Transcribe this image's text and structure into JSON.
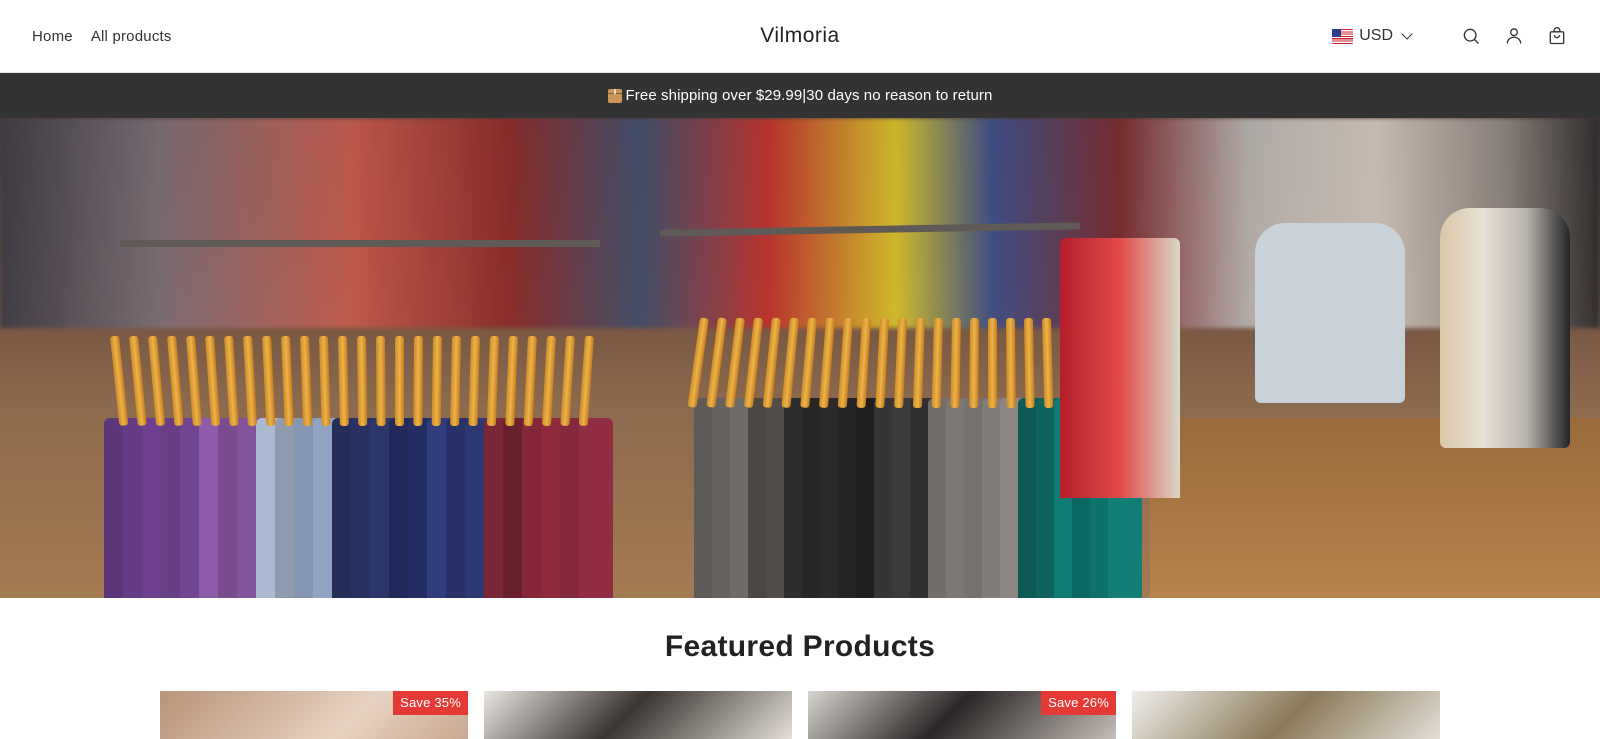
{
  "nav": {
    "home": "Home",
    "all_products": "All products"
  },
  "brand": "Vilmoria",
  "currency": {
    "code": "USD",
    "flag": "us-flag-icon"
  },
  "announcement": "Free shipping over $29.99|30 days no reason to return",
  "featured": {
    "title": "Featured Products",
    "cards": [
      {
        "badge": "Save 35%"
      },
      {
        "badge": ""
      },
      {
        "badge": "Save 26%"
      },
      {
        "badge": ""
      }
    ]
  },
  "colors": {
    "announcement_bg": "#333333",
    "sale_badge": "#e53935"
  }
}
